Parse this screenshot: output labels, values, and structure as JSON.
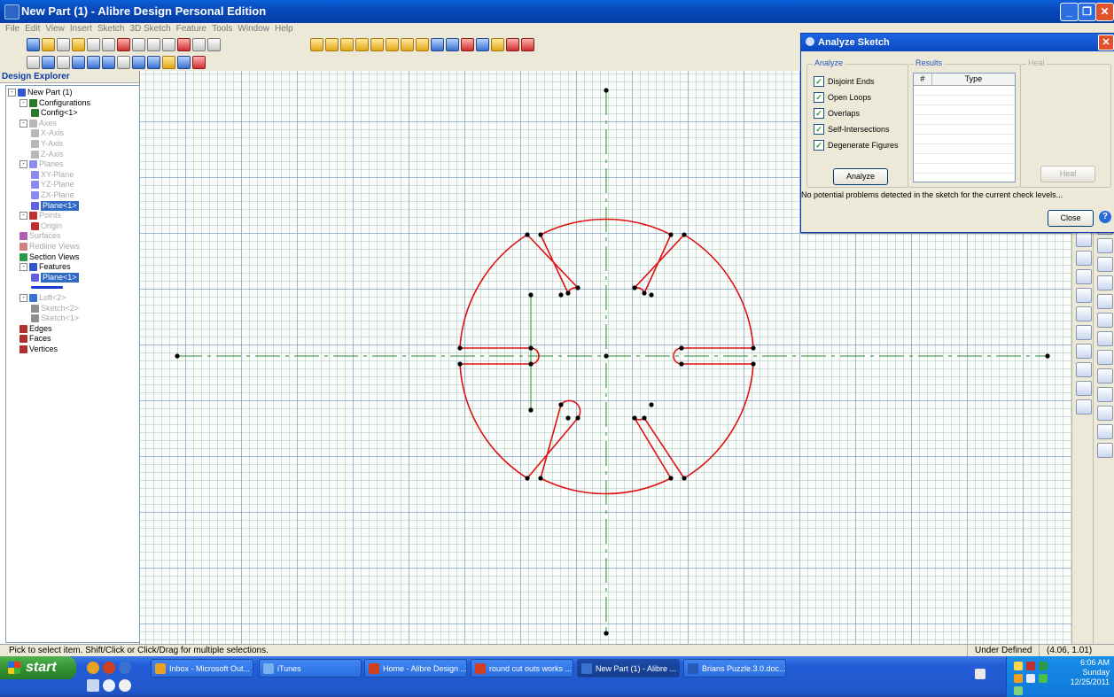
{
  "window": {
    "title": "New Part (1) - Alibre Design Personal Edition"
  },
  "menu": [
    "File",
    "Edit",
    "View",
    "Insert",
    "Sketch",
    "3D Sketch",
    "Feature",
    "Tools",
    "Window",
    "Help"
  ],
  "explorer": {
    "header": "Design Explorer",
    "tree": [
      {
        "label": "New Part (1)",
        "depth": 0,
        "icon": "part-icon",
        "color": "#3355cc",
        "greyed": false,
        "exp": "-"
      },
      {
        "label": "Configurations",
        "depth": 1,
        "icon": "configurations-icon",
        "color": "#2a7a2a",
        "greyed": false,
        "exp": "-"
      },
      {
        "label": "Config<1>",
        "depth": 2,
        "icon": "config-icon",
        "color": "#2a7a2a",
        "greyed": false,
        "exp": ""
      },
      {
        "label": "Axes",
        "depth": 1,
        "icon": "axes-icon",
        "color": "#b8b8b8",
        "greyed": true,
        "exp": "-"
      },
      {
        "label": "X-Axis",
        "depth": 2,
        "icon": "axis-icon",
        "color": "#b8b8b8",
        "greyed": true,
        "exp": ""
      },
      {
        "label": "Y-Axis",
        "depth": 2,
        "icon": "axis-icon",
        "color": "#b8b8b8",
        "greyed": true,
        "exp": ""
      },
      {
        "label": "Z-Axis",
        "depth": 2,
        "icon": "axis-icon",
        "color": "#b8b8b8",
        "greyed": true,
        "exp": ""
      },
      {
        "label": "Planes",
        "depth": 1,
        "icon": "planes-icon",
        "color": "#8c8cf0",
        "greyed": true,
        "exp": "-"
      },
      {
        "label": "XY-Plane",
        "depth": 2,
        "icon": "plane-icon",
        "color": "#8c8cf0",
        "greyed": true,
        "exp": ""
      },
      {
        "label": "YZ-Plane",
        "depth": 2,
        "icon": "plane-icon",
        "color": "#8c8cf0",
        "greyed": true,
        "exp": ""
      },
      {
        "label": "ZX-Plane",
        "depth": 2,
        "icon": "plane-icon",
        "color": "#8c8cf0",
        "greyed": true,
        "exp": ""
      },
      {
        "label": "Plane<1>",
        "depth": 2,
        "icon": "plane-icon",
        "color": "#6060e0",
        "greyed": false,
        "selected": true,
        "exp": ""
      },
      {
        "label": "Points",
        "depth": 1,
        "icon": "points-icon",
        "color": "#c03030",
        "greyed": true,
        "exp": "-"
      },
      {
        "label": "Origin",
        "depth": 2,
        "icon": "origin-icon",
        "color": "#c03030",
        "greyed": true,
        "exp": ""
      },
      {
        "label": "Surfaces",
        "depth": 1,
        "icon": "surfaces-icon",
        "color": "#b060b0",
        "greyed": true,
        "exp": ""
      },
      {
        "label": "Redline Views",
        "depth": 1,
        "icon": "redline-icon",
        "color": "#d08080",
        "greyed": true,
        "exp": ""
      },
      {
        "label": "Section Views",
        "depth": 1,
        "icon": "section-views-icon",
        "color": "#2a9a4a",
        "greyed": false,
        "exp": ""
      },
      {
        "label": "Features",
        "depth": 1,
        "icon": "features-icon",
        "color": "#3355cc",
        "greyed": false,
        "exp": "-"
      },
      {
        "label": "Plane<1>",
        "depth": 2,
        "icon": "plane-icon",
        "color": "#6060e0",
        "greyed": false,
        "selected": true,
        "exp": ""
      },
      {
        "label": "",
        "depth": 2,
        "icon": "rollback-marker-icon",
        "color": "#1a3ad0",
        "greyed": false,
        "exp": "",
        "marker": true
      },
      {
        "label": "Loft<2>",
        "depth": 1,
        "icon": "loft-icon",
        "color": "#3a70d0",
        "greyed": true,
        "exp": "-"
      },
      {
        "label": "Sketch<2>",
        "depth": 2,
        "icon": "sketch-icon",
        "color": "#909090",
        "greyed": true,
        "exp": ""
      },
      {
        "label": "Sketch<1>",
        "depth": 2,
        "icon": "sketch-icon",
        "color": "#909090",
        "greyed": true,
        "exp": ""
      },
      {
        "label": "Edges",
        "depth": 1,
        "icon": "edges-icon",
        "color": "#b03030",
        "greyed": false,
        "exp": ""
      },
      {
        "label": "Faces",
        "depth": 1,
        "icon": "faces-icon",
        "color": "#b03030",
        "greyed": false,
        "exp": ""
      },
      {
        "label": "Vertices",
        "depth": 1,
        "icon": "vertices-icon",
        "color": "#b03030",
        "greyed": false,
        "exp": ""
      }
    ]
  },
  "dialog": {
    "title": "Analyze Sketch",
    "analyze_group": "Analyze",
    "results_group": "Results",
    "heal_group": "Heal",
    "checks": [
      {
        "label": "Disjoint Ends",
        "checked": true
      },
      {
        "label": "Open Loops",
        "checked": true
      },
      {
        "label": "Overlaps",
        "checked": true
      },
      {
        "label": "Self-Intersections",
        "checked": true
      },
      {
        "label": "Degenerate Figures",
        "checked": true
      }
    ],
    "results_columns": [
      "#",
      "Type"
    ],
    "analyze_button": "Analyze",
    "heal_button": "Heal",
    "close_button": "Close",
    "message": "No potential problems detected in the sketch for the current check levels..."
  },
  "status": {
    "hint": "Pick to select item. Shift/Click or Click/Drag for multiple selections.",
    "state": "Under Defined",
    "coords": "(4.06, 1.01)"
  },
  "taskbar": {
    "start": "start",
    "tasks": [
      {
        "label": "Inbox - Microsoft Out...",
        "active": false,
        "icon_color": "#e8a020"
      },
      {
        "label": "iTunes",
        "active": false,
        "icon_color": "#7ab0f0"
      },
      {
        "label": "Home - Alibre Design ...",
        "active": false,
        "icon_color": "#d04020"
      },
      {
        "label": "round cut outs works ...",
        "active": false,
        "icon_color": "#d04020"
      },
      {
        "label": "New Part (1) - Alibre ...",
        "active": true,
        "icon_color": "#3a70d0"
      },
      {
        "label": "Brians Puzzle.3.0.doc...",
        "active": false,
        "icon_color": "#2a5ab8"
      }
    ],
    "clock": {
      "time": "6:06 AM",
      "day": "Sunday",
      "date": "12/25/2011"
    }
  },
  "colors": {
    "sketch_line": "#e01010",
    "construction_line": "#2e8b2e",
    "grid_major": "#7896c8",
    "accent": "#0a47c0"
  }
}
